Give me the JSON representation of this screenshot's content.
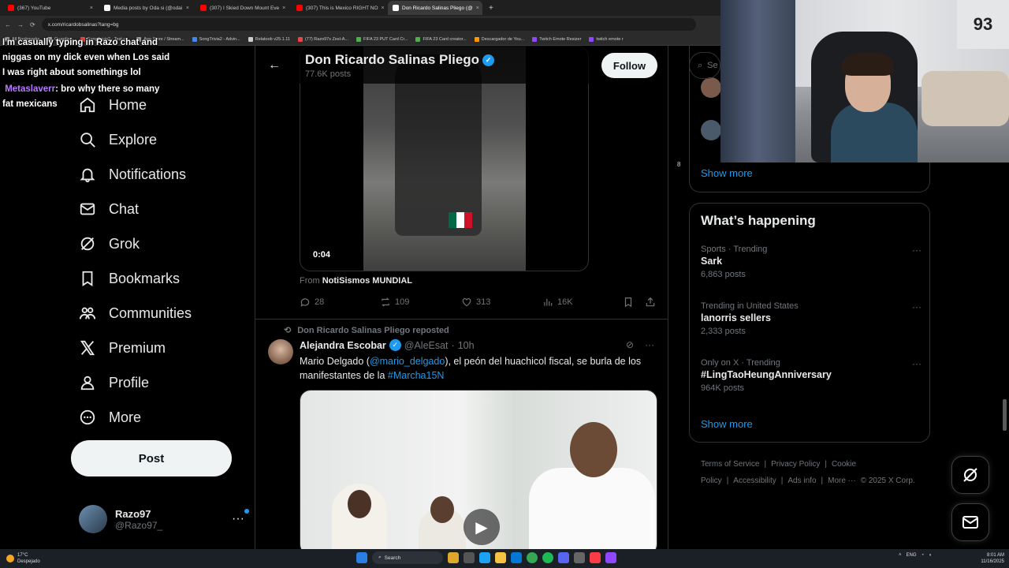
{
  "browser": {
    "tabs": [
      {
        "title": "(367) YouTube",
        "fav": "#ff0000"
      },
      {
        "title": "Media posts by Oda si (@odai",
        "fav": "#ffffff"
      },
      {
        "title": "(307) I Skied Down Mount Eve",
        "fav": "#ff0000"
      },
      {
        "title": "(307) This is Mexico RIGHT NO",
        "fav": "#ff0000"
      },
      {
        "title": "Don Ricardo Salinas Pliego (@",
        "fav": "#ffffff"
      }
    ],
    "new_tab": "+",
    "url": "x.com/ricardobsalinas?lang=bg",
    "bookmarks": [
      "All Bookmarks",
      "Guardian",
      "SongTrivia2 - Test y...",
      "App Store / Stream...",
      "SongTrivia2 - Advin...",
      "Relatoob v25.1.11",
      "(77) Razo97s Zesl-A...",
      "FIFA 23 PUT Card Cr...",
      "FIFA 23 Card creator...",
      "Descargador de You...",
      "Twitch Emote Resizer",
      "twitch emote r"
    ]
  },
  "chat_overlay": {
    "messages": [
      {
        "user": "",
        "text": "I'm casually typing in Razo chat and niggas on my dick even when Los said I was right about somethings lol"
      },
      {
        "user": "Metaslaverr",
        "text": ": bro why there so many fat mexicans"
      }
    ]
  },
  "nav": {
    "items": [
      {
        "label": "Home",
        "icon": "home-icon"
      },
      {
        "label": "Explore",
        "icon": "search-icon"
      },
      {
        "label": "Notifications",
        "icon": "bell-icon"
      },
      {
        "label": "Chat",
        "icon": "mail-icon"
      },
      {
        "label": "Grok",
        "icon": "grok-icon"
      },
      {
        "label": "Bookmarks",
        "icon": "bookmark-icon"
      },
      {
        "label": "Communities",
        "icon": "people-icon"
      },
      {
        "label": "Premium",
        "icon": "x-logo-icon"
      },
      {
        "label": "Profile",
        "icon": "person-icon"
      },
      {
        "label": "More",
        "icon": "more-circle-icon"
      }
    ],
    "post_label": "Post",
    "account": {
      "name": "Razo97",
      "handle": "@Razo97_"
    }
  },
  "feed": {
    "profile_name": "Don Ricardo Salinas Pliego",
    "post_count": "77.6K posts",
    "follow_label": "Follow",
    "video_time": "0:04",
    "from_prefix": "From",
    "from_source": "NotiSismos MUNDIAL",
    "stats": {
      "replies": "28",
      "reposts": "109",
      "likes": "313",
      "views": "16K"
    },
    "repost_label": "Don Ricardo Salinas Pliego reposted",
    "tweet": {
      "author": "Alejandra Escobar",
      "handle": "@AleEsat",
      "dot": "·",
      "time": "10h",
      "text_1": "Mario Delgado (",
      "mention": "@mario_delgado",
      "text_2": "), el peón del huachicol fiscal, se burla de los manifestantes de la ",
      "hashtag": "#Marcha15N"
    }
  },
  "sidebar": {
    "search_placeholder": "Se",
    "show_more_1": "Show more",
    "small_number": "8",
    "happening_title": "What’s happening",
    "trends": [
      {
        "context": "Sports · Trending",
        "title": "Sark",
        "posts": "6,863 posts"
      },
      {
        "context": "Trending in United States",
        "title": "lanorris sellers",
        "posts": "2,333 posts"
      },
      {
        "context": "Only on X · Trending",
        "title": "#LingTaoHeungAnniversary",
        "posts": "964K posts"
      }
    ],
    "show_more_2": "Show more",
    "footer": [
      "Terms of Service",
      "|",
      "Privacy Policy",
      "|",
      "Cookie Policy",
      "|",
      "Accessibility",
      "|",
      "Ads info",
      "|",
      "More ···",
      "© 2025 X Corp."
    ]
  },
  "webcam": {
    "jersey_number": "93"
  },
  "taskbar": {
    "weather_temp": "17°C",
    "weather_desc": "Despejado",
    "search": "Search",
    "lang": "ENG",
    "time": "8:01 AM",
    "date": "11/16/2025"
  }
}
